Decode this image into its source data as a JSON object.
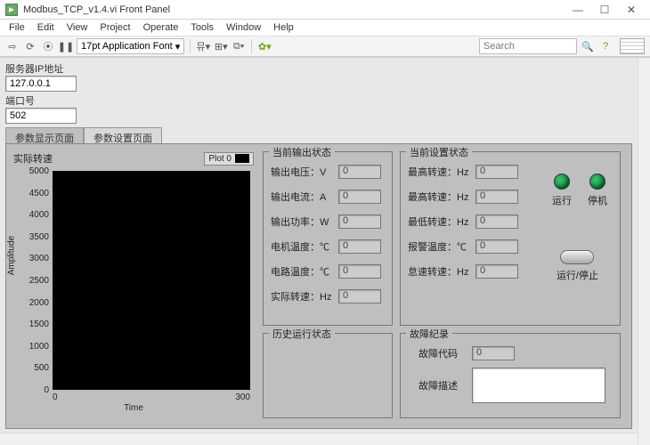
{
  "window": {
    "title": "Modbus_TCP_v1.4.vi Front Panel"
  },
  "menu": {
    "file": "File",
    "edit": "Edit",
    "view": "View",
    "project": "Project",
    "operate": "Operate",
    "tools": "Tools",
    "window": "Window",
    "help": "Help"
  },
  "toolbar": {
    "font": "17pt Application Font",
    "search_placeholder": "Search"
  },
  "config": {
    "ip_label": "服务器IP地址",
    "ip_value": "127.0.0.1",
    "port_label": "端口号",
    "port_value": "502"
  },
  "tabs": {
    "display": "参数显示页面",
    "settings": "参数设置页面"
  },
  "chart": {
    "title": "实际转速",
    "legend": "Plot 0",
    "yticks": [
      "5000",
      "4500",
      "4000",
      "3500",
      "3000",
      "2500",
      "2000",
      "1500",
      "1000",
      "500",
      "0"
    ],
    "xticks": [
      "0",
      "300"
    ],
    "xlabel": "Time",
    "ylabel": "Amplitude"
  },
  "output_group": {
    "title": "当前输出状态",
    "rows": [
      {
        "label": "输出电压：V",
        "value": "0"
      },
      {
        "label": "输出电流：A",
        "value": "0"
      },
      {
        "label": "输出功率：W",
        "value": "0"
      },
      {
        "label": "电机温度：℃",
        "value": "0"
      },
      {
        "label": "电路温度：℃",
        "value": "0"
      },
      {
        "label": "实际转速：Hz",
        "value": "0"
      }
    ]
  },
  "history_group": {
    "title": "历史运行状态"
  },
  "setting_group": {
    "title": "当前设置状态",
    "rows": [
      {
        "label": "最高转速：Hz",
        "value": "0"
      },
      {
        "label": "最高转速：Hz",
        "value": "0"
      },
      {
        "label": "最低转速：Hz",
        "value": "0"
      },
      {
        "label": "报警温度：℃",
        "value": "0"
      },
      {
        "label": "怠速转速：Hz",
        "value": "0"
      }
    ],
    "led_run": "运行",
    "led_stop": "停机",
    "btn": "运行/停止"
  },
  "fault_group": {
    "title": "故障纪录",
    "code_label": "故障代码",
    "code_value": "0",
    "desc_label": "故障描述"
  },
  "chart_data": {
    "type": "line",
    "title": "实际转速",
    "xlabel": "Time",
    "ylabel": "Amplitude",
    "xlim": [
      0,
      300
    ],
    "ylim": [
      0,
      5000
    ],
    "series": [
      {
        "name": "Plot 0",
        "values": []
      }
    ]
  }
}
